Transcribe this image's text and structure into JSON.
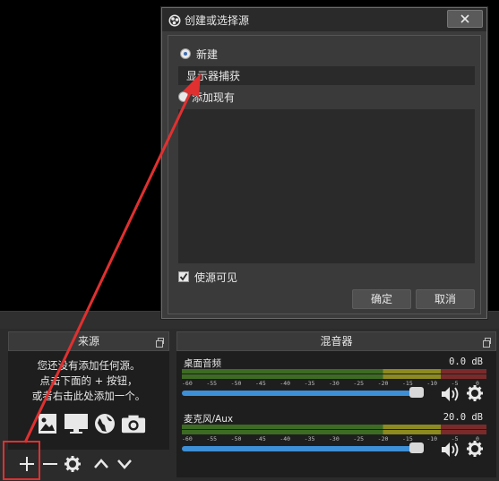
{
  "dialog": {
    "title": "创建或选择源",
    "radio_new_label": "新建",
    "new_source_name": "显示器捕获",
    "radio_existing_label": "添加现有",
    "visible_checkbox_label": "使源可见",
    "ok_label": "确定",
    "cancel_label": "取消"
  },
  "sources_dock": {
    "title": "来源",
    "empty_hint_lines": [
      "您还没有添加任何源。",
      "点击下面的 + 按钮，",
      "或者右击此处添加一个。"
    ]
  },
  "mixer_dock": {
    "title": "混音器",
    "tracks": [
      {
        "name": "桌面音频",
        "db": "0.0 dB",
        "volume_fraction": 0.95
      },
      {
        "name": "麦克风/Aux",
        "db": "20.0 dB",
        "volume_fraction": 0.95
      }
    ],
    "ticks": [
      "-60",
      "-55",
      "-50",
      "-45",
      "-40",
      "-35",
      "-30",
      "-25",
      "-20",
      "-15",
      "-10",
      "-5",
      "0"
    ]
  },
  "colors": {
    "accent_blue": "#3d8fd6",
    "annotation_red": "#e03030"
  },
  "icons": [
    "obs-logo-icon",
    "close-icon",
    "image-icon",
    "monitor-icon",
    "globe-icon",
    "camera-icon",
    "plus-icon",
    "minus-icon",
    "gear-icon",
    "chevron-up-icon",
    "chevron-down-icon",
    "volume-icon",
    "float-icon"
  ]
}
